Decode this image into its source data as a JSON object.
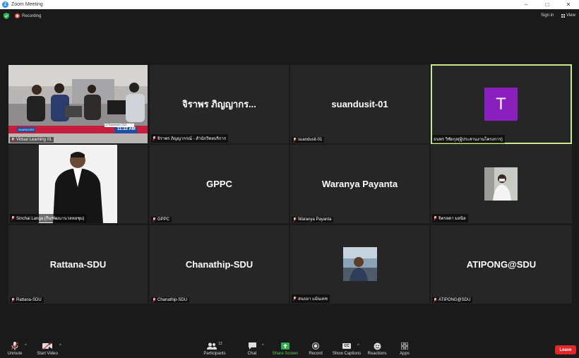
{
  "window": {
    "title": "Zoom Meeting",
    "logo": "Z"
  },
  "topbar": {
    "recording": "Recording",
    "sign_in": "Sign in",
    "view": "View"
  },
  "tiles": [
    {
      "display": "",
      "label": "Virtual Learning 01",
      "ticker_brand": "SUANDUSIT",
      "ticker_date": "22 September 2021",
      "ticker_time": "11:22 AM"
    },
    {
      "display": "จิราพร ภิญญากร...",
      "label": "จิราพร ภิญญากรณ์ - สำนักวิทยบริการ"
    },
    {
      "display": "suandusit-01",
      "label": "suandusit-01"
    },
    {
      "display": "",
      "avatar": "T",
      "label": "ธนพร วิชัยกุล(ผู้ประสานงานโครงการ)",
      "active": true
    },
    {
      "display": "",
      "label": "Sinchai Langa (กีบ/พัฒนานวลหอชุม)"
    },
    {
      "display": "GPPC",
      "label": "GPPC"
    },
    {
      "display": "Waranya Payanta",
      "label": "Waranya Payanta"
    },
    {
      "display": "",
      "label": "จิตรลดา มลนิล"
    },
    {
      "display": "Rattana-SDU",
      "label": "Rattana-SDU"
    },
    {
      "display": "Chanathip-SDU",
      "label": "Chanathip-SDU"
    },
    {
      "display": "",
      "label": "สนธยา แม้นเดช"
    },
    {
      "display": "ATIPONG@SDU",
      "label": "ATIPONG@SDU"
    }
  ],
  "toolbar": {
    "unmute": "Unmute",
    "start_video": "Start Video",
    "participants": "Participants",
    "participants_count": "12",
    "chat": "Chat",
    "share_screen": "Share Screen",
    "record": "Record",
    "show_captions": "Show Captions",
    "captions_icon": "CC",
    "reactions": "Reactions",
    "apps": "Apps",
    "leave": "Leave",
    "caret": "^"
  },
  "colors": {
    "active_border": "#c9e98d",
    "leave": "#e02828",
    "share": "#5ac85a",
    "avatar": "#8b1fbd"
  }
}
